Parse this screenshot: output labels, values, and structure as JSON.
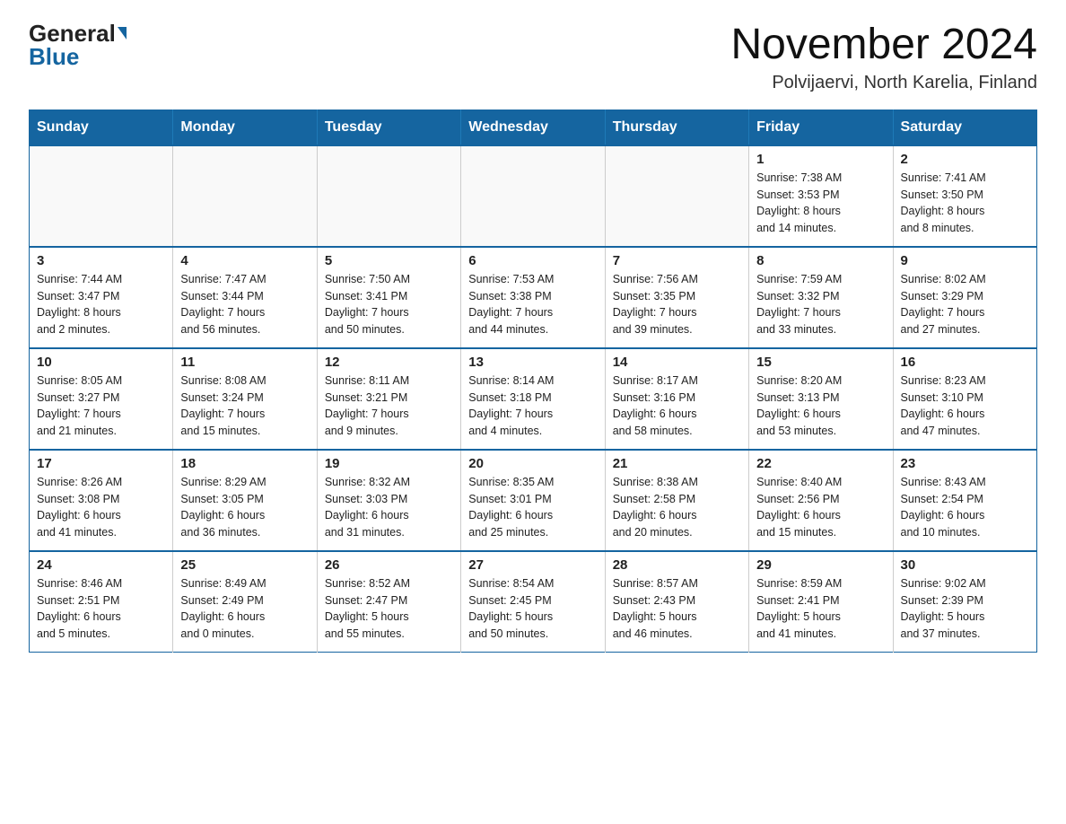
{
  "logo": {
    "general": "General",
    "blue": "Blue"
  },
  "title": "November 2024",
  "location": "Polvijaervi, North Karelia, Finland",
  "weekdays": [
    "Sunday",
    "Monday",
    "Tuesday",
    "Wednesday",
    "Thursday",
    "Friday",
    "Saturday"
  ],
  "weeks": [
    [
      {
        "day": "",
        "info": ""
      },
      {
        "day": "",
        "info": ""
      },
      {
        "day": "",
        "info": ""
      },
      {
        "day": "",
        "info": ""
      },
      {
        "day": "",
        "info": ""
      },
      {
        "day": "1",
        "info": "Sunrise: 7:38 AM\nSunset: 3:53 PM\nDaylight: 8 hours\nand 14 minutes."
      },
      {
        "day": "2",
        "info": "Sunrise: 7:41 AM\nSunset: 3:50 PM\nDaylight: 8 hours\nand 8 minutes."
      }
    ],
    [
      {
        "day": "3",
        "info": "Sunrise: 7:44 AM\nSunset: 3:47 PM\nDaylight: 8 hours\nand 2 minutes."
      },
      {
        "day": "4",
        "info": "Sunrise: 7:47 AM\nSunset: 3:44 PM\nDaylight: 7 hours\nand 56 minutes."
      },
      {
        "day": "5",
        "info": "Sunrise: 7:50 AM\nSunset: 3:41 PM\nDaylight: 7 hours\nand 50 minutes."
      },
      {
        "day": "6",
        "info": "Sunrise: 7:53 AM\nSunset: 3:38 PM\nDaylight: 7 hours\nand 44 minutes."
      },
      {
        "day": "7",
        "info": "Sunrise: 7:56 AM\nSunset: 3:35 PM\nDaylight: 7 hours\nand 39 minutes."
      },
      {
        "day": "8",
        "info": "Sunrise: 7:59 AM\nSunset: 3:32 PM\nDaylight: 7 hours\nand 33 minutes."
      },
      {
        "day": "9",
        "info": "Sunrise: 8:02 AM\nSunset: 3:29 PM\nDaylight: 7 hours\nand 27 minutes."
      }
    ],
    [
      {
        "day": "10",
        "info": "Sunrise: 8:05 AM\nSunset: 3:27 PM\nDaylight: 7 hours\nand 21 minutes."
      },
      {
        "day": "11",
        "info": "Sunrise: 8:08 AM\nSunset: 3:24 PM\nDaylight: 7 hours\nand 15 minutes."
      },
      {
        "day": "12",
        "info": "Sunrise: 8:11 AM\nSunset: 3:21 PM\nDaylight: 7 hours\nand 9 minutes."
      },
      {
        "day": "13",
        "info": "Sunrise: 8:14 AM\nSunset: 3:18 PM\nDaylight: 7 hours\nand 4 minutes."
      },
      {
        "day": "14",
        "info": "Sunrise: 8:17 AM\nSunset: 3:16 PM\nDaylight: 6 hours\nand 58 minutes."
      },
      {
        "day": "15",
        "info": "Sunrise: 8:20 AM\nSunset: 3:13 PM\nDaylight: 6 hours\nand 53 minutes."
      },
      {
        "day": "16",
        "info": "Sunrise: 8:23 AM\nSunset: 3:10 PM\nDaylight: 6 hours\nand 47 minutes."
      }
    ],
    [
      {
        "day": "17",
        "info": "Sunrise: 8:26 AM\nSunset: 3:08 PM\nDaylight: 6 hours\nand 41 minutes."
      },
      {
        "day": "18",
        "info": "Sunrise: 8:29 AM\nSunset: 3:05 PM\nDaylight: 6 hours\nand 36 minutes."
      },
      {
        "day": "19",
        "info": "Sunrise: 8:32 AM\nSunset: 3:03 PM\nDaylight: 6 hours\nand 31 minutes."
      },
      {
        "day": "20",
        "info": "Sunrise: 8:35 AM\nSunset: 3:01 PM\nDaylight: 6 hours\nand 25 minutes."
      },
      {
        "day": "21",
        "info": "Sunrise: 8:38 AM\nSunset: 2:58 PM\nDaylight: 6 hours\nand 20 minutes."
      },
      {
        "day": "22",
        "info": "Sunrise: 8:40 AM\nSunset: 2:56 PM\nDaylight: 6 hours\nand 15 minutes."
      },
      {
        "day": "23",
        "info": "Sunrise: 8:43 AM\nSunset: 2:54 PM\nDaylight: 6 hours\nand 10 minutes."
      }
    ],
    [
      {
        "day": "24",
        "info": "Sunrise: 8:46 AM\nSunset: 2:51 PM\nDaylight: 6 hours\nand 5 minutes."
      },
      {
        "day": "25",
        "info": "Sunrise: 8:49 AM\nSunset: 2:49 PM\nDaylight: 6 hours\nand 0 minutes."
      },
      {
        "day": "26",
        "info": "Sunrise: 8:52 AM\nSunset: 2:47 PM\nDaylight: 5 hours\nand 55 minutes."
      },
      {
        "day": "27",
        "info": "Sunrise: 8:54 AM\nSunset: 2:45 PM\nDaylight: 5 hours\nand 50 minutes."
      },
      {
        "day": "28",
        "info": "Sunrise: 8:57 AM\nSunset: 2:43 PM\nDaylight: 5 hours\nand 46 minutes."
      },
      {
        "day": "29",
        "info": "Sunrise: 8:59 AM\nSunset: 2:41 PM\nDaylight: 5 hours\nand 41 minutes."
      },
      {
        "day": "30",
        "info": "Sunrise: 9:02 AM\nSunset: 2:39 PM\nDaylight: 5 hours\nand 37 minutes."
      }
    ]
  ]
}
